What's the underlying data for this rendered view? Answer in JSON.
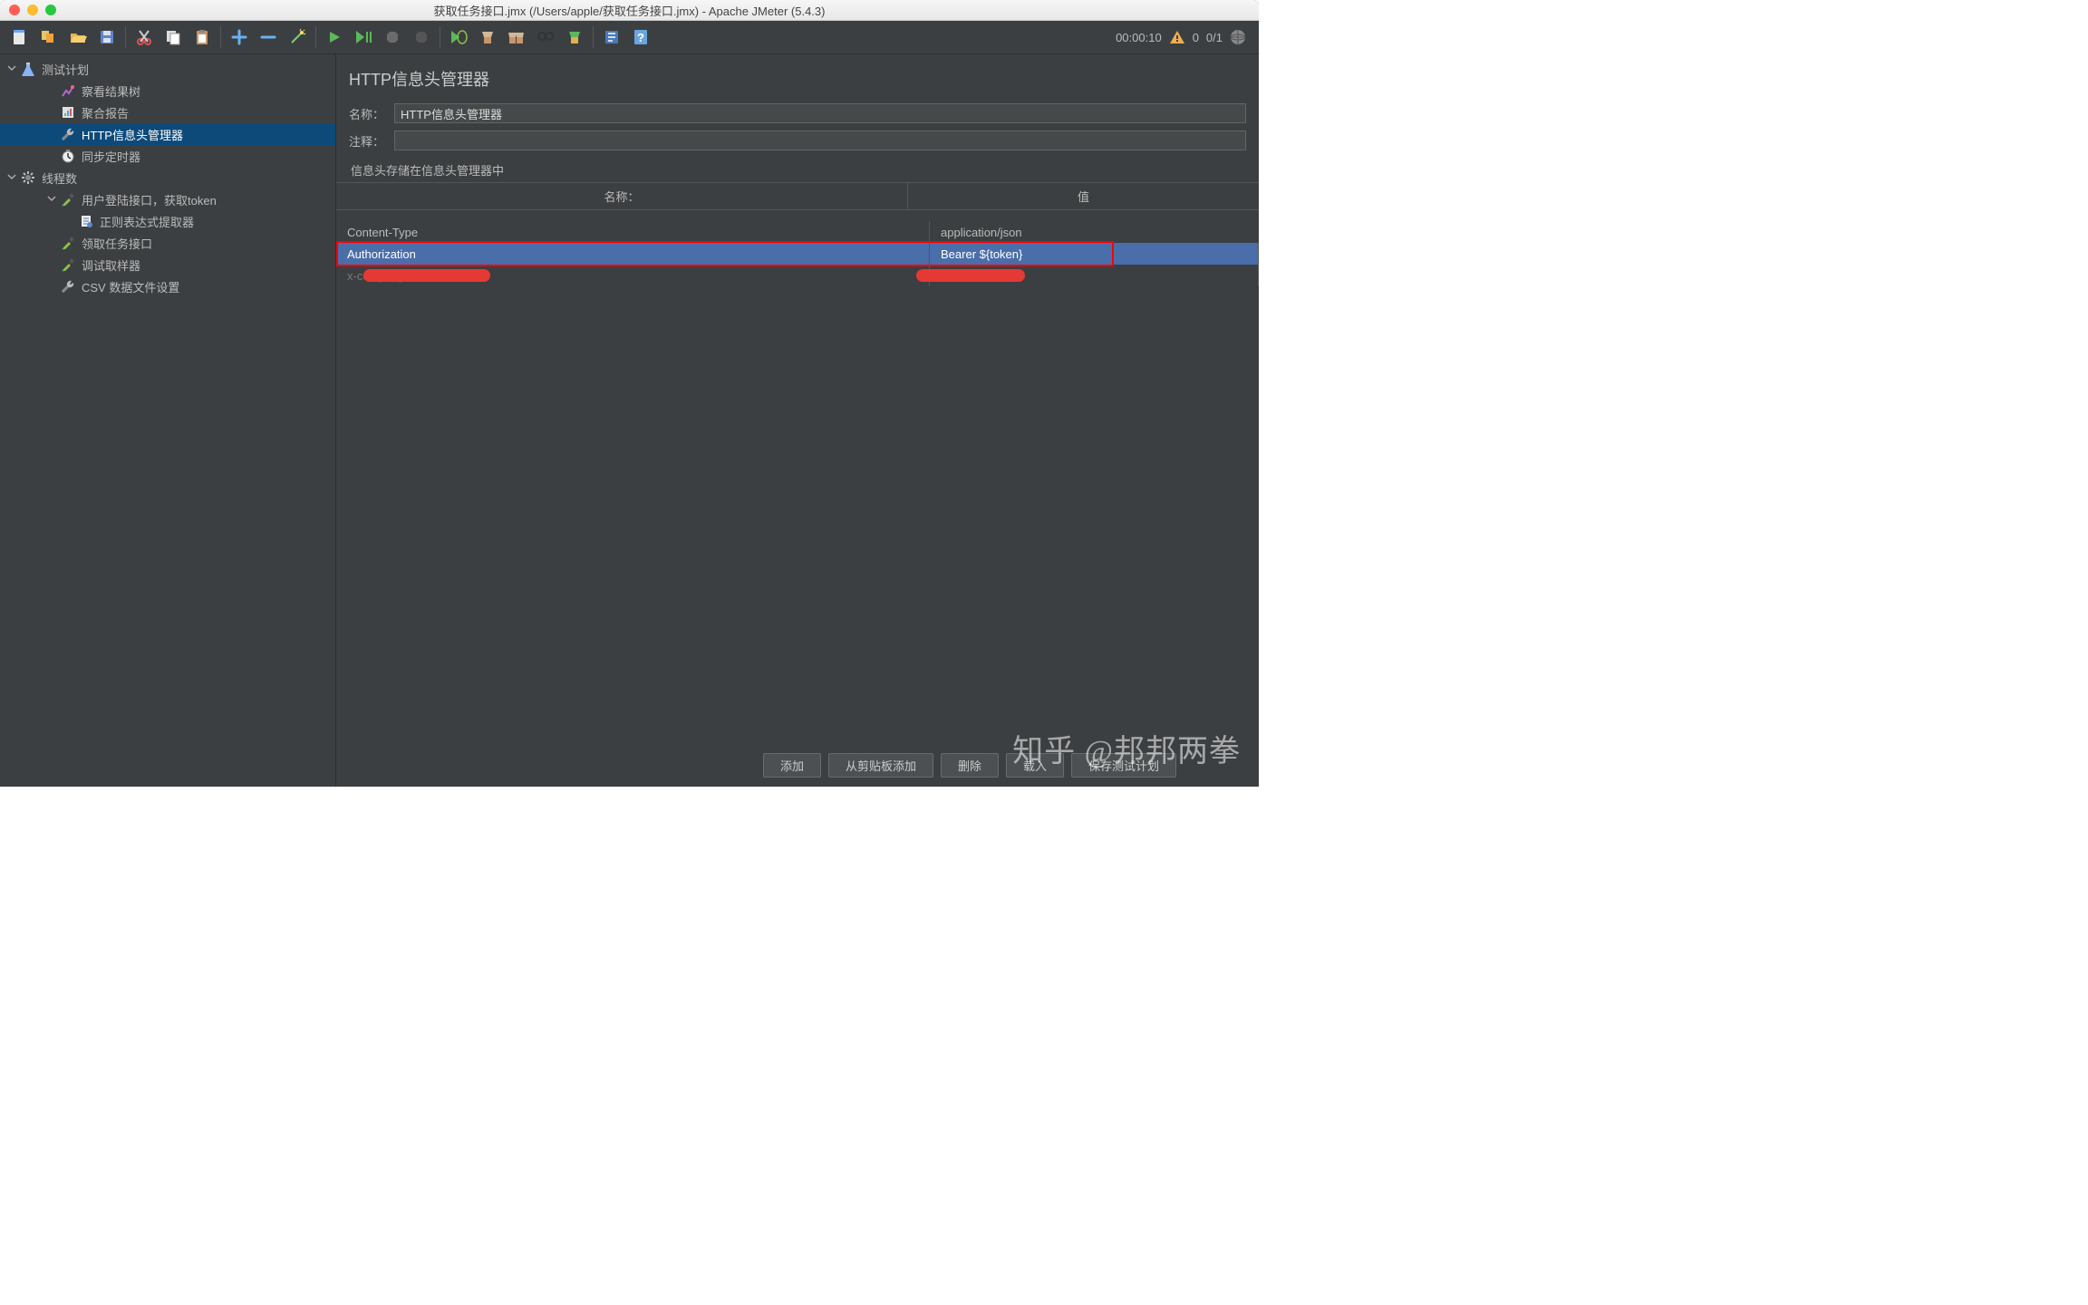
{
  "window": {
    "title": "获取任务接口.jmx (/Users/apple/获取任务接口.jmx) - Apache JMeter (5.4.3)"
  },
  "status": {
    "time": "00:00:10",
    "active": "0",
    "total": "0/1"
  },
  "tree": [
    {
      "level": 0,
      "arrow": "down",
      "icon": "flask",
      "label": "测试计划",
      "sel": false
    },
    {
      "level": 1,
      "arrow": "",
      "icon": "graph",
      "label": "察看结果树",
      "sel": false
    },
    {
      "level": 1,
      "arrow": "",
      "icon": "report",
      "label": "聚合报告",
      "sel": false
    },
    {
      "level": 1,
      "arrow": "",
      "icon": "wrench",
      "label": "HTTP信息头管理器",
      "sel": true
    },
    {
      "level": 1,
      "arrow": "",
      "icon": "timer",
      "label": "同步定时器",
      "sel": false
    },
    {
      "level": 0,
      "arrow": "down",
      "icon": "gear",
      "label": "线程数",
      "sel": false
    },
    {
      "level": 1,
      "arrow": "down",
      "icon": "dropper",
      "label": "用户登陆接口，获取token",
      "sel": false
    },
    {
      "level": 2,
      "arrow": "",
      "icon": "doc",
      "label": "正则表达式提取器",
      "sel": false
    },
    {
      "level": 1,
      "arrow": "",
      "icon": "dropper",
      "label": "领取任务接口",
      "sel": false
    },
    {
      "level": 1,
      "arrow": "",
      "icon": "dropper",
      "label": "调试取样器",
      "sel": false
    },
    {
      "level": 1,
      "arrow": "",
      "icon": "wrench",
      "label": "CSV 数据文件设置",
      "sel": false
    }
  ],
  "panel": {
    "title": "HTTP信息头管理器",
    "fields": {
      "name_label": "名称：",
      "name_value": "HTTP信息头管理器",
      "comment_label": "注释：",
      "comment_value": ""
    },
    "section": "信息头存储在信息头管理器中",
    "headers_table": {
      "cols": [
        "名称：",
        "值"
      ],
      "rows": [
        {
          "name": "Content-Type",
          "value": "application/json",
          "sel": false,
          "hl": false,
          "redact": false
        },
        {
          "name": "Authorization",
          "value": "Bearer ${token}",
          "sel": true,
          "hl": true,
          "redact": false
        },
        {
          "name": "x-company-an...",
          "value": "",
          "sel": false,
          "hl": false,
          "redact": true
        }
      ]
    },
    "buttons": [
      "添加",
      "从剪贴板添加",
      "删除",
      "载入",
      "保存测试计划"
    ]
  },
  "watermark": "知乎 @邦邦两拳"
}
